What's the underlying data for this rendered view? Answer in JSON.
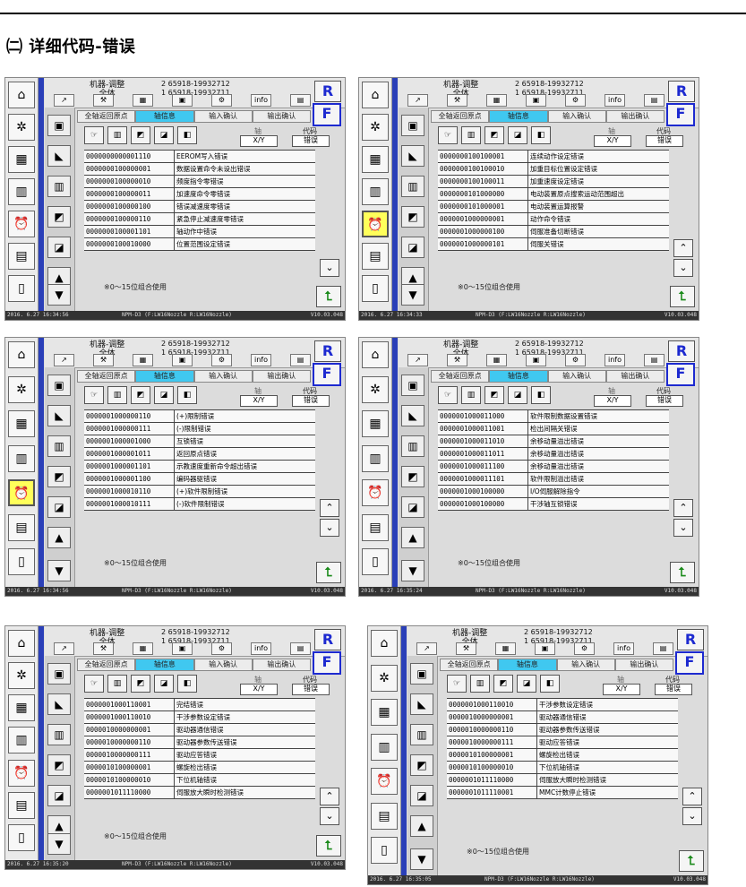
{
  "heading": "㈡ 详细代码-错误",
  "common": {
    "title_l1": "机器-调整",
    "title_l2": "全体",
    "id1": "65918-19932712",
    "id2": "65918-19932711",
    "id1_no": "2",
    "id2_no": "1",
    "btn_r": "R",
    "btn_f": "F",
    "tabs": [
      "全轴返回原点",
      "轴信息",
      "输入确认",
      "输出确认"
    ],
    "axis_label": "轴",
    "axis_value": "X/Y",
    "code_label": "代码",
    "code_value": "错误",
    "note": "※0～15位组合使用",
    "status_model": "NPM-D3 (F:LW16Nozzle R:LW16Nozzle)",
    "version": "V10.03.048"
  },
  "screens": [
    {
      "timestamp": "2016. 6.27 16:34:56",
      "highlight": -1,
      "scroll_up": false,
      "rows": [
        {
          "code": "0000000000001110",
          "msg": "EEROM写入错误"
        },
        {
          "code": "0000000100000001",
          "msg": "数据设置命令未设出错误"
        },
        {
          "code": "0000000100000010",
          "msg": "频度指令零错误"
        },
        {
          "code": "0000000100000011",
          "msg": "加速度命令零错误"
        },
        {
          "code": "0000000100000100",
          "msg": "错误减速度零错误"
        },
        {
          "code": "0000000100000110",
          "msg": "紧急停止减速度零错误"
        },
        {
          "code": "0000000100001101",
          "msg": "轴动作中错误"
        },
        {
          "code": "0000000100010000",
          "msg": "位置范围设定错误"
        }
      ]
    },
    {
      "timestamp": "2016. 6.27 16:34:33",
      "highlight": 3,
      "scroll_up": true,
      "rows": [
        {
          "code": "0000000100100001",
          "msg": "连续动作设定错误"
        },
        {
          "code": "0000000100100010",
          "msg": "加重目标位置设定错误"
        },
        {
          "code": "0000000100100011",
          "msg": "加重速度设定错误"
        },
        {
          "code": "0000000101000000",
          "msg": "电动装置原点搜索运动范围超出"
        },
        {
          "code": "0000000101000001",
          "msg": "电动装置运算报警"
        },
        {
          "code": "0000001000000001",
          "msg": "动作命令错误"
        },
        {
          "code": "0000001000000100",
          "msg": "伺服准备切断错误"
        },
        {
          "code": "0000001000000101",
          "msg": "伺服关错误"
        }
      ]
    },
    {
      "timestamp": "2016. 6.27 16:34:56",
      "highlight": 3,
      "scroll_up": true,
      "rows": [
        {
          "code": "0000001000000110",
          "msg": "(+)限制错误"
        },
        {
          "code": "0000001000000111",
          "msg": "(-)限制错误"
        },
        {
          "code": "0000001000001000",
          "msg": "互锁错误"
        },
        {
          "code": "0000001000001011",
          "msg": "返回原点错误"
        },
        {
          "code": "0000001000001101",
          "msg": "示教速度重新命令超出错误"
        },
        {
          "code": "0000001000001100",
          "msg": "编码器驱错误"
        },
        {
          "code": "0000001000010110",
          "msg": "(+)软件限制错误"
        },
        {
          "code": "0000001000010111",
          "msg": "(-)软件限制错误"
        }
      ]
    },
    {
      "timestamp": "2016. 6.27 16:35:24",
      "highlight": -1,
      "scroll_up": true,
      "rows": [
        {
          "code": "0000001000011000",
          "msg": "软件限制数据设置错误"
        },
        {
          "code": "0000001000011001",
          "msg": "检出间隔关错误"
        },
        {
          "code": "0000001000011010",
          "msg": "余移动量溢出错误"
        },
        {
          "code": "0000001000011011",
          "msg": "余移动量溢出错误"
        },
        {
          "code": "0000001000011100",
          "msg": "余移动量溢出错误"
        },
        {
          "code": "0000001000011101",
          "msg": "软件限制溢出错误"
        },
        {
          "code": "0000001000100000",
          "msg": "I/O伺服解除指令"
        },
        {
          "code": "0000001000100000",
          "msg": "干涉轴互锁错误"
        }
      ]
    },
    {
      "timestamp": "2016. 6.27 16:35:20",
      "highlight": -1,
      "scroll_up": true,
      "rows": [
        {
          "code": "0000001000110001",
          "msg": "完结错误"
        },
        {
          "code": "0000001000110010",
          "msg": "干涉参数设定错误"
        },
        {
          "code": "0000010000000001",
          "msg": "驱动器通信错误"
        },
        {
          "code": "0000010000000110",
          "msg": "驱动器参数传送错误"
        },
        {
          "code": "0000010000000111",
          "msg": "驱动应答错误"
        },
        {
          "code": "0000010100000001",
          "msg": "螺旋检出错误"
        },
        {
          "code": "0000010100000010",
          "msg": "下位机轴错误"
        },
        {
          "code": "0000001011110000",
          "msg": "伺服放大瞬时检测错误"
        }
      ]
    },
    {
      "timestamp": "2016. 6.27 16:35:05",
      "highlight": -1,
      "scroll_up": true,
      "rows": [
        {
          "code": "0000001000110010",
          "msg": "干涉参数设定错误"
        },
        {
          "code": "0000010000000001",
          "msg": "驱动器通信错误"
        },
        {
          "code": "0000010000000110",
          "msg": "驱动器参数传送错误"
        },
        {
          "code": "0000010000000111",
          "msg": "驱动应答错误"
        },
        {
          "code": "0000010100000001",
          "msg": "螺旋检出错误"
        },
        {
          "code": "0000010100000010",
          "msg": "下位机轴错误"
        },
        {
          "code": "0000001011110000",
          "msg": "伺服放大瞬时检测错误"
        },
        {
          "code": "0000001011110001",
          "msg": "MMC计数停止错误"
        }
      ]
    }
  ],
  "icons": {
    "left": [
      "home-icon",
      "fan-icon",
      "board-icon",
      "chart-icon",
      "alarm-icon",
      "pcb-icon",
      "device-icon"
    ],
    "mid": [
      "panel-icon",
      "tool-icon",
      "feeder-icon",
      "nozzle-icon",
      "tray-icon",
      "pickup-icon"
    ]
  }
}
